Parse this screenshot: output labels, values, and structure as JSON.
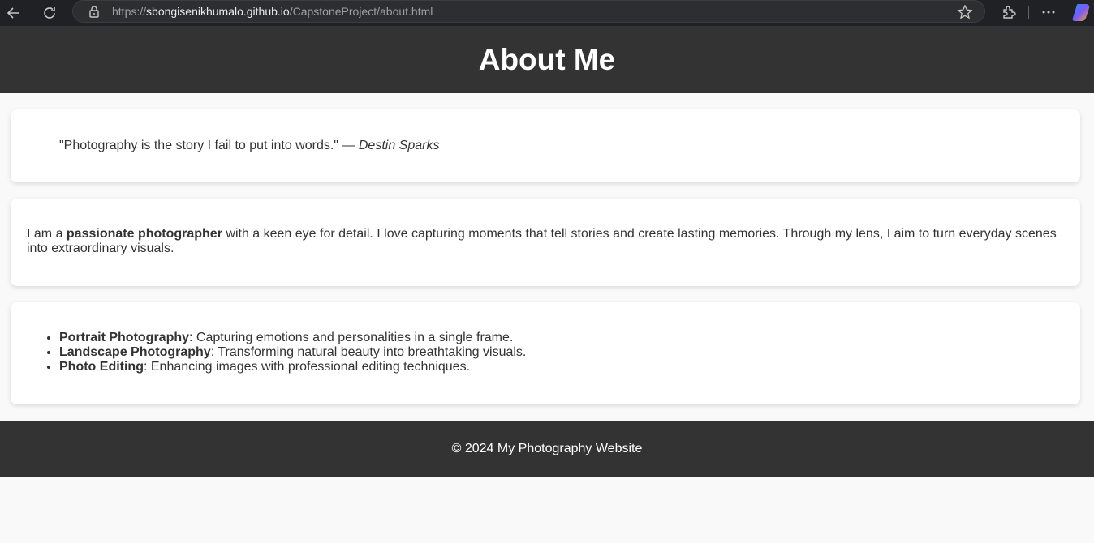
{
  "browser": {
    "url_scheme": "https://",
    "url_host": "sbongisenikhumalo.github.io",
    "url_path": "/CapstoneProject/about.html"
  },
  "header": {
    "title": "About Me"
  },
  "quote": {
    "text": "\"Photography is the story I fail to put into words.\" — ",
    "author": "Destin Sparks"
  },
  "about": {
    "prefix": "I am a ",
    "highlight": "passionate photographer",
    "suffix": " with a keen eye for detail. I love capturing moments that tell stories and create lasting memories. Through my lens, I aim to turn everyday scenes into extraordinary visuals."
  },
  "services": [
    {
      "title": "Portrait Photography",
      "desc": ": Capturing emotions and personalities in a single frame."
    },
    {
      "title": "Landscape Photography",
      "desc": ": Transforming natural beauty into breathtaking visuals."
    },
    {
      "title": "Photo Editing",
      "desc": ": Enhancing images with professional editing techniques."
    }
  ],
  "footer": {
    "text": "© 2024 My Photography Website"
  },
  "colors": {
    "header_bg": "#333333",
    "page_bg": "#f9f9f9",
    "card_bg": "#ffffff"
  }
}
